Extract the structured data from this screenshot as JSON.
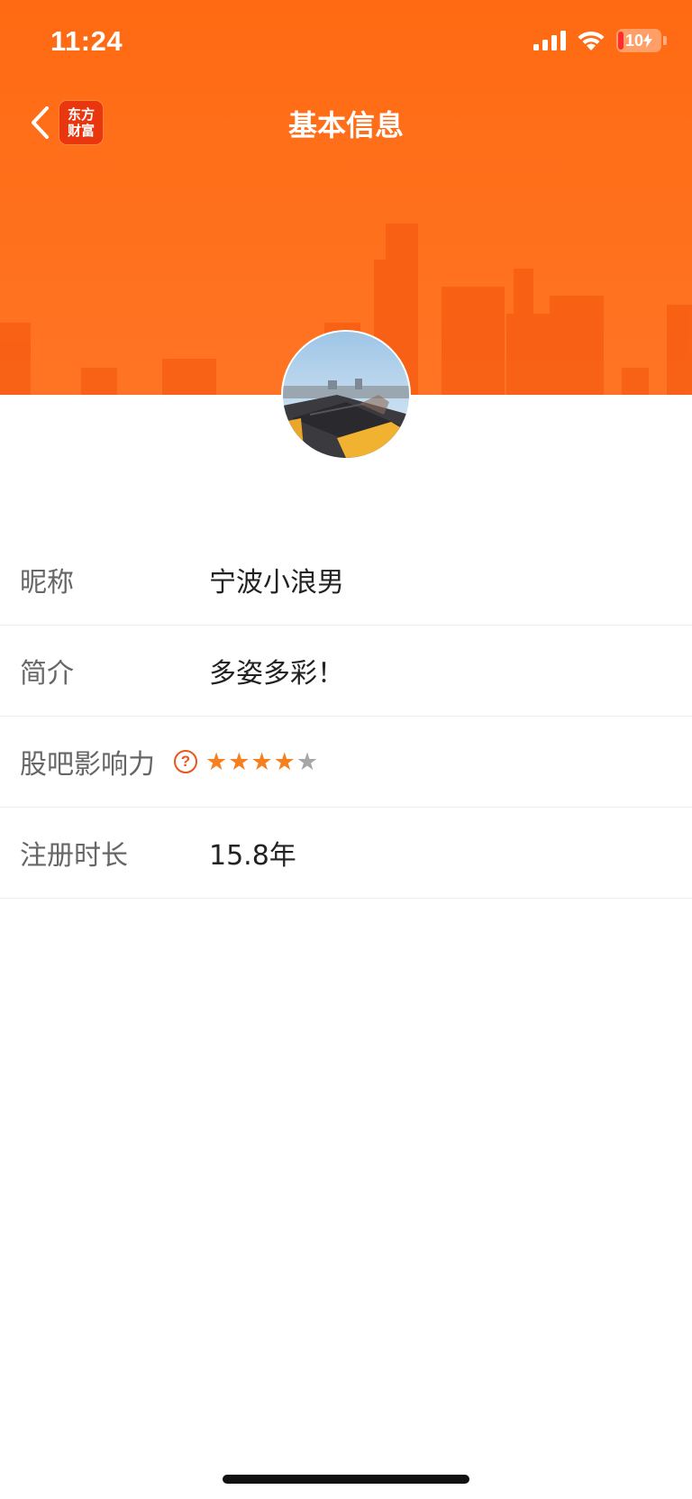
{
  "status_bar": {
    "time": "11:24",
    "battery_level": "10",
    "signal_icon": "cellular-signal-icon",
    "wifi_icon": "wifi-icon"
  },
  "nav": {
    "title": "基本信息",
    "back_icon": "chevron-left-icon",
    "logo_line1": "东方",
    "logo_line2": "财富"
  },
  "profile": {
    "avatar_icon": "avatar-photo"
  },
  "info": {
    "rows": [
      {
        "label": "昵称",
        "value": "宁波小浪男"
      },
      {
        "label": "简介",
        "value": "多姿多彩！"
      },
      {
        "label": "股吧影响力",
        "help_icon_text": "?",
        "rating": 4,
        "rating_max": 5
      },
      {
        "label": "注册时长",
        "value": "15.8年"
      }
    ]
  },
  "colors": {
    "brand_orange": "#ff6a12",
    "star_active": "#f77f1e",
    "star_inactive": "#a6a6a6",
    "help_icon": "#e9561a",
    "logo_red": "#e8360f"
  }
}
